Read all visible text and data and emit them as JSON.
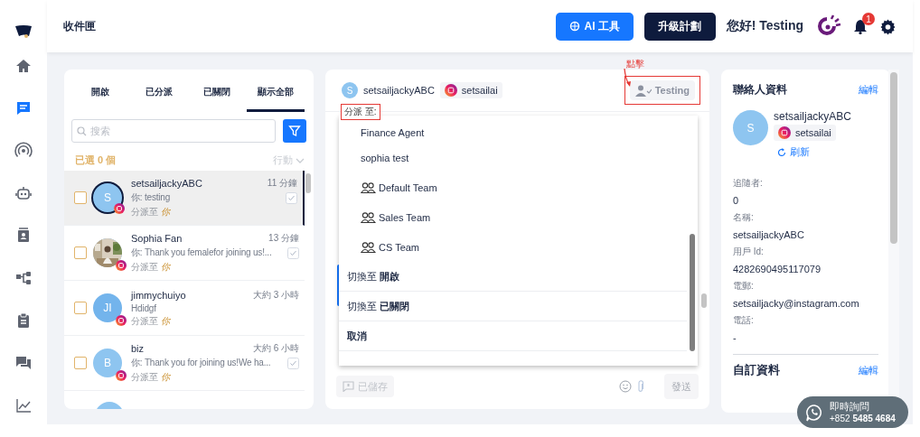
{
  "sidebar": {
    "items": [
      {
        "kind": "logo"
      },
      {
        "kind": "home",
        "selected": false
      },
      {
        "kind": "inbox",
        "selected": true
      },
      {
        "kind": "broadcast",
        "selected": false
      },
      {
        "kind": "bot",
        "selected": false
      },
      {
        "kind": "contacts",
        "selected": false
      },
      {
        "kind": "flow",
        "selected": false
      },
      {
        "kind": "clipboard",
        "selected": false
      },
      {
        "kind": "chats",
        "selected": false
      },
      {
        "kind": "chart",
        "selected": false
      }
    ]
  },
  "header": {
    "title": "收件匣",
    "buttons": [
      {
        "label": "AI 工具",
        "kind": "ai"
      },
      {
        "label": "升級計劃",
        "kind": "upgrade"
      }
    ],
    "greeting": "您好! Testing",
    "notification_count": "1"
  },
  "inbox": {
    "tabs": [
      {
        "label": "開啟",
        "selected": false
      },
      {
        "label": "已分派",
        "selected": false
      },
      {
        "label": "已關閉",
        "selected": false
      },
      {
        "label": "顯示全部",
        "selected": true
      }
    ],
    "search": {
      "placeholder": "搜索"
    },
    "selected_count": "已選 0 個",
    "action": "行動",
    "conversations": [
      {
        "name": "setsailjackyABC",
        "time": "11 分鐘",
        "preview": "你: testing",
        "assigned_label": "分派至",
        "assigned_to": "你",
        "avatar": {
          "kind": "initials",
          "text": "S"
        },
        "selected": true,
        "seen": true
      },
      {
        "name": "Sophia Fan",
        "time": "13 分鐘",
        "preview": "你: Thank you femalefor joining us!...",
        "assigned_label": "分派至",
        "assigned_to": "你",
        "selected": false,
        "seen": true
      },
      {
        "name": "jimmychuiyo",
        "time": "大約 3 小時",
        "preview": "Hdidgf",
        "assigned_label": "分派至",
        "assigned_to": "你",
        "avatar": {
          "kind": "initials",
          "text": "JI"
        },
        "selected": false,
        "seen": false
      },
      {
        "name": "biz",
        "time": "大約 6 小時",
        "preview": "你: Thank you for joining us!We ha...",
        "assigned_label": "分派至",
        "assigned_to": "你",
        "avatar": {
          "kind": "initials",
          "text": "B"
        },
        "selected": false,
        "seen": true
      }
    ]
  },
  "conversation": {
    "name": "setsailjackyABC",
    "avatar": "S",
    "channel": "setsailai",
    "assignee": "Testing",
    "annotation": "點擊",
    "assign_menu": {
      "label": "分派 至:",
      "options": [
        {
          "label": "Finance Agent",
          "kind": "agent"
        },
        {
          "label": "sophia test",
          "kind": "agent"
        },
        {
          "label": "Default Team",
          "kind": "team"
        },
        {
          "label": "Sales Team",
          "kind": "team"
        },
        {
          "label": "CS Team",
          "kind": "team"
        },
        {
          "label": "切換至 **開啟**",
          "kind": "action"
        },
        {
          "label": "切換至 **已關閉**",
          "kind": "action"
        },
        {
          "label": "取消",
          "kind": "cancel"
        }
      ]
    },
    "saved_replies": "已儲存",
    "send": {
      "label": "發送",
      "disabled": true
    }
  },
  "contact": {
    "title": "聯絡人資料",
    "edit": "編輯",
    "avatar": "S",
    "name": "setsailjackyABC",
    "channel": "setsailai",
    "refresh": "刷新",
    "fields": [
      {
        "label": "追隨者:",
        "value": "0"
      },
      {
        "label": "名稱:",
        "value": "setsailjackyABC"
      },
      {
        "label": "用戶 Id:",
        "value": "4282690495117079"
      },
      {
        "label": "電郵:",
        "value": "setsailjacky@instagram.com"
      },
      {
        "label": "電話:",
        "value": "-"
      }
    ],
    "custom_title": "自訂資料",
    "custom_edit": "編輯"
  },
  "chat_widget": {
    "title": "即時詢問",
    "prefix": "+852",
    "phone": "5485 4684"
  }
}
